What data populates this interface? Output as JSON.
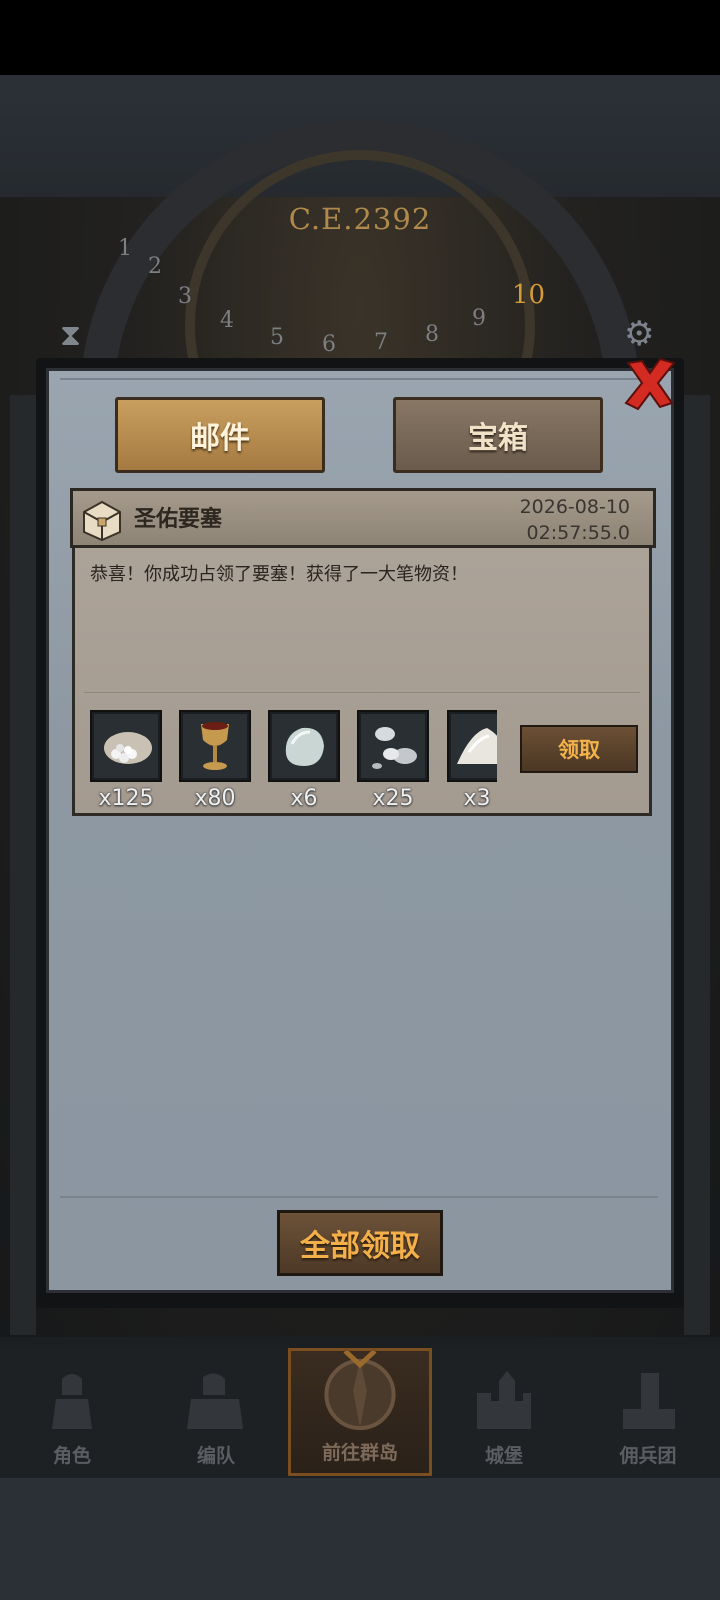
{
  "game": {
    "era_label": "C.E.2392",
    "dial_numbers": [
      "1",
      "2",
      "3",
      "4",
      "5",
      "6",
      "7",
      "8",
      "9",
      "10"
    ]
  },
  "tabs": {
    "mail": "邮件",
    "chest": "宝箱"
  },
  "mail": {
    "title": "圣佑要塞",
    "date": "2026-08-10",
    "time": "02:57:55.0",
    "body": "恭喜！你成功占领了要塞！获得了一大笔物资！",
    "claim_label": "领取",
    "rewards": [
      {
        "icon": "coin-sack-icon",
        "count": "x125"
      },
      {
        "icon": "goblet-icon",
        "count": "x80"
      },
      {
        "icon": "moonstone-icon",
        "count": "x6"
      },
      {
        "icon": "silver-ore-icon",
        "count": "x25"
      },
      {
        "icon": "salt-pile-icon",
        "count": "x3"
      }
    ]
  },
  "claim_all_label": "全部领取",
  "nav": [
    {
      "label": "角色",
      "icon": "knight-icon"
    },
    {
      "label": "编队",
      "icon": "formation-icon"
    },
    {
      "label": "前往群岛",
      "icon": "compass-icon",
      "active": true
    },
    {
      "label": "城堡",
      "icon": "castle-icon"
    },
    {
      "label": "佣兵团",
      "icon": "mercenary-icon"
    }
  ],
  "colors": {
    "accent_gold": "#f3b04a",
    "panel": "#9aa5b0",
    "close_red": "#d32a22"
  }
}
